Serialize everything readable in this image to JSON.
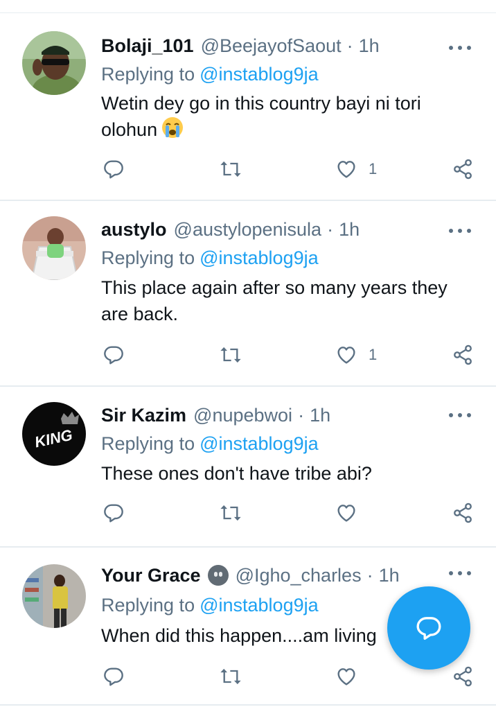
{
  "tweets": [
    {
      "name": "Bolaji_101",
      "handle": "@BeejayofSaout",
      "dot": "·",
      "time": "1h",
      "replying_prefix": "Replying to",
      "replying_to": "@instablog9ja",
      "text": "Wetin dey go in this country bayi ni tori olohun",
      "text_emoji": "loudly-crying-face-emoji",
      "likes": "1"
    },
    {
      "name": "austylo",
      "handle": "@austylopenisula",
      "dot": "·",
      "time": "1h",
      "replying_prefix": "Replying to",
      "replying_to": "@instablog9ja",
      "text": "This place again after so many years they are back.",
      "likes": "1"
    },
    {
      "name": "Sir Kazim",
      "handle": "@nupebwoi",
      "dot": "·",
      "time": "1h",
      "replying_prefix": "Replying to",
      "replying_to": "@instablog9ja",
      "text": "These ones don't have tribe abi?",
      "avatar_text": "KING",
      "likes": ""
    },
    {
      "name": "Your Grace",
      "name_emoji": "neutral-face-emoji",
      "handle": "@Igho_charles",
      "dot": "·",
      "time": "1h",
      "replying_prefix": "Replying to",
      "replying_to": "@instablog9ja",
      "text": "When did this happen....am living",
      "likes": ""
    }
  ],
  "icons": {
    "reply": "reply-icon",
    "retweet": "retweet-icon",
    "like": "heart-icon",
    "share": "share-icon",
    "more": "more-options-icon",
    "compose": "compose-reply-icon"
  },
  "colors": {
    "accent": "#1da1f2",
    "secondary_text": "#5b7083",
    "divider": "#e6ecf0"
  }
}
